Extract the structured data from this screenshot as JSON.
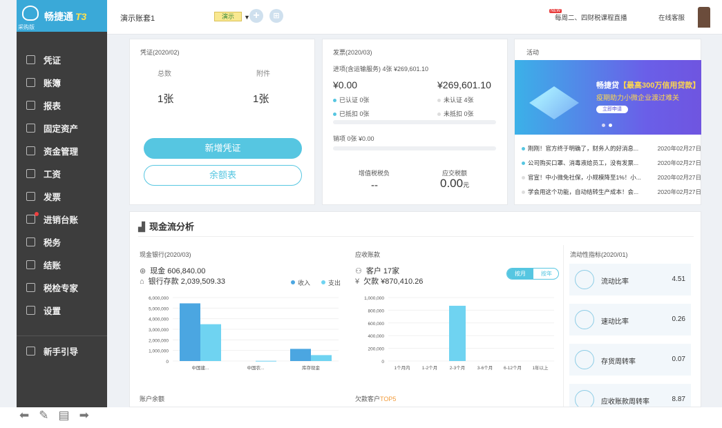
{
  "app": {
    "brand": "畅捷通",
    "brand_suffix": "T3",
    "edition": "采购版"
  },
  "sidebar": {
    "items": [
      {
        "label": "凭证",
        "icon": "voucher-icon"
      },
      {
        "label": "账簿",
        "icon": "ledger-icon"
      },
      {
        "label": "报表",
        "icon": "report-icon"
      },
      {
        "label": "固定资产",
        "icon": "asset-icon"
      },
      {
        "label": "资金管理",
        "icon": "fund-icon"
      },
      {
        "label": "工资",
        "icon": "salary-icon"
      },
      {
        "label": "发票",
        "icon": "invoice-icon"
      },
      {
        "label": "进销台账",
        "icon": "inventory-icon"
      },
      {
        "label": "税务",
        "icon": "tax-icon"
      },
      {
        "label": "结账",
        "icon": "closing-icon"
      },
      {
        "label": "税检专家",
        "icon": "tax-check-icon"
      },
      {
        "label": "设置",
        "icon": "settings-icon"
      }
    ],
    "guide": "新手引导"
  },
  "topbar": {
    "account": "演示账套1",
    "env_badge": "演示",
    "new_tag": "NEW",
    "notice": "每周二、四财税课程直播",
    "service": "在线客服"
  },
  "voucher": {
    "title": "凭证(2020/02)",
    "total_label": "总数",
    "total_value": "1张",
    "attach_label": "附件",
    "attach_value": "1张",
    "new_button": "新增凭证",
    "balance_button": "余额表"
  },
  "invoice": {
    "title": "发票(2020/03)",
    "input_summary": "进项(含运输服务) 4张  ¥269,601.10",
    "amount_left": "¥0.00",
    "amount_right": "¥269,601.10",
    "certified": "已认证  0张",
    "uncertified": "未认证  4张",
    "deducted": "已抵扣  0张",
    "undeducted": "未抵扣  0张",
    "output": "销项   0张   ¥0.00",
    "vat_label": "增值税税负",
    "vat_value": "--",
    "tax_label": "应交税额",
    "tax_value": "0.00",
    "tax_unit": "元"
  },
  "activity": {
    "title": "活动",
    "banner_brand": "畅捷贷",
    "banner_highlight": "【最高300万信用贷款】",
    "banner_sub": "疫期助力小微企业渡过难关",
    "banner_btn": "立即申请",
    "news": [
      {
        "text": "刚刚！官方终于明确了，财务人的好消息...",
        "date": "2020年02月27日"
      },
      {
        "text": "公司购买口罩、消毒液给员工，没有发票...",
        "date": "2020年02月27日"
      },
      {
        "text": "官宣！中小微免社保，小规模降至1%！小...",
        "date": "2020年02月27日"
      },
      {
        "text": "学会用这个功能，自动结转生产成本！会...",
        "date": "2020年02月27日"
      }
    ]
  },
  "cashflow": {
    "title": "现金流分析",
    "bank_title": "现金银行(2020/03)",
    "cash_line": "现金  606,840.00",
    "bank_line": "银行存款  2,039,509.33",
    "legend_in": "收入",
    "legend_out": "支出",
    "ar_title": "应收账款",
    "customer_line": "客户  17家",
    "owed_line": "欠款  ¥870,410.26",
    "toggle_month": "按月",
    "toggle_year": "按年",
    "liquidity_title": "流动性指标(2020/01)",
    "ratios": [
      {
        "label": "流动比率",
        "value": "4.51",
        "icon": "flask-icon"
      },
      {
        "label": "速动比率",
        "value": "0.26",
        "icon": "rocket-icon"
      },
      {
        "label": "存货周转率",
        "value": "0.07",
        "icon": "box-icon"
      },
      {
        "label": "应收账款周转率",
        "value": "8.87",
        "icon": "coin-icon"
      }
    ],
    "account_balance": "账户余额",
    "top5_prefix": "欠款客户",
    "top5_suffix": "TOP5"
  },
  "chart_data": [
    {
      "type": "bar",
      "categories": [
        "中国建...",
        "中国农...",
        "库存现金"
      ],
      "series": [
        {
          "name": "收入",
          "values": [
            5450000,
            0,
            1150000
          ],
          "color": "#4ba6e1"
        },
        {
          "name": "支出",
          "values": [
            3480000,
            20000,
            560000
          ],
          "color": "#6fd3f1"
        }
      ],
      "ylim": [
        0,
        6000000
      ],
      "yticks": [
        "6,000,000",
        "5,000,000",
        "4,000,000",
        "3,000,000",
        "2,000,000",
        "1,000,000",
        "0"
      ]
    },
    {
      "type": "bar",
      "categories": [
        "1个月内",
        "1-2个月",
        "2-3个月",
        "3-6个月",
        "6-12个月",
        "1年以上"
      ],
      "values": [
        0,
        0,
        870410.26,
        0,
        0,
        0
      ],
      "color": "#6fd3f1",
      "ylim": [
        0,
        1000000
      ],
      "yticks": [
        "1,000,000",
        "800,000",
        "600,000",
        "400,000",
        "200,000",
        "0"
      ]
    }
  ]
}
